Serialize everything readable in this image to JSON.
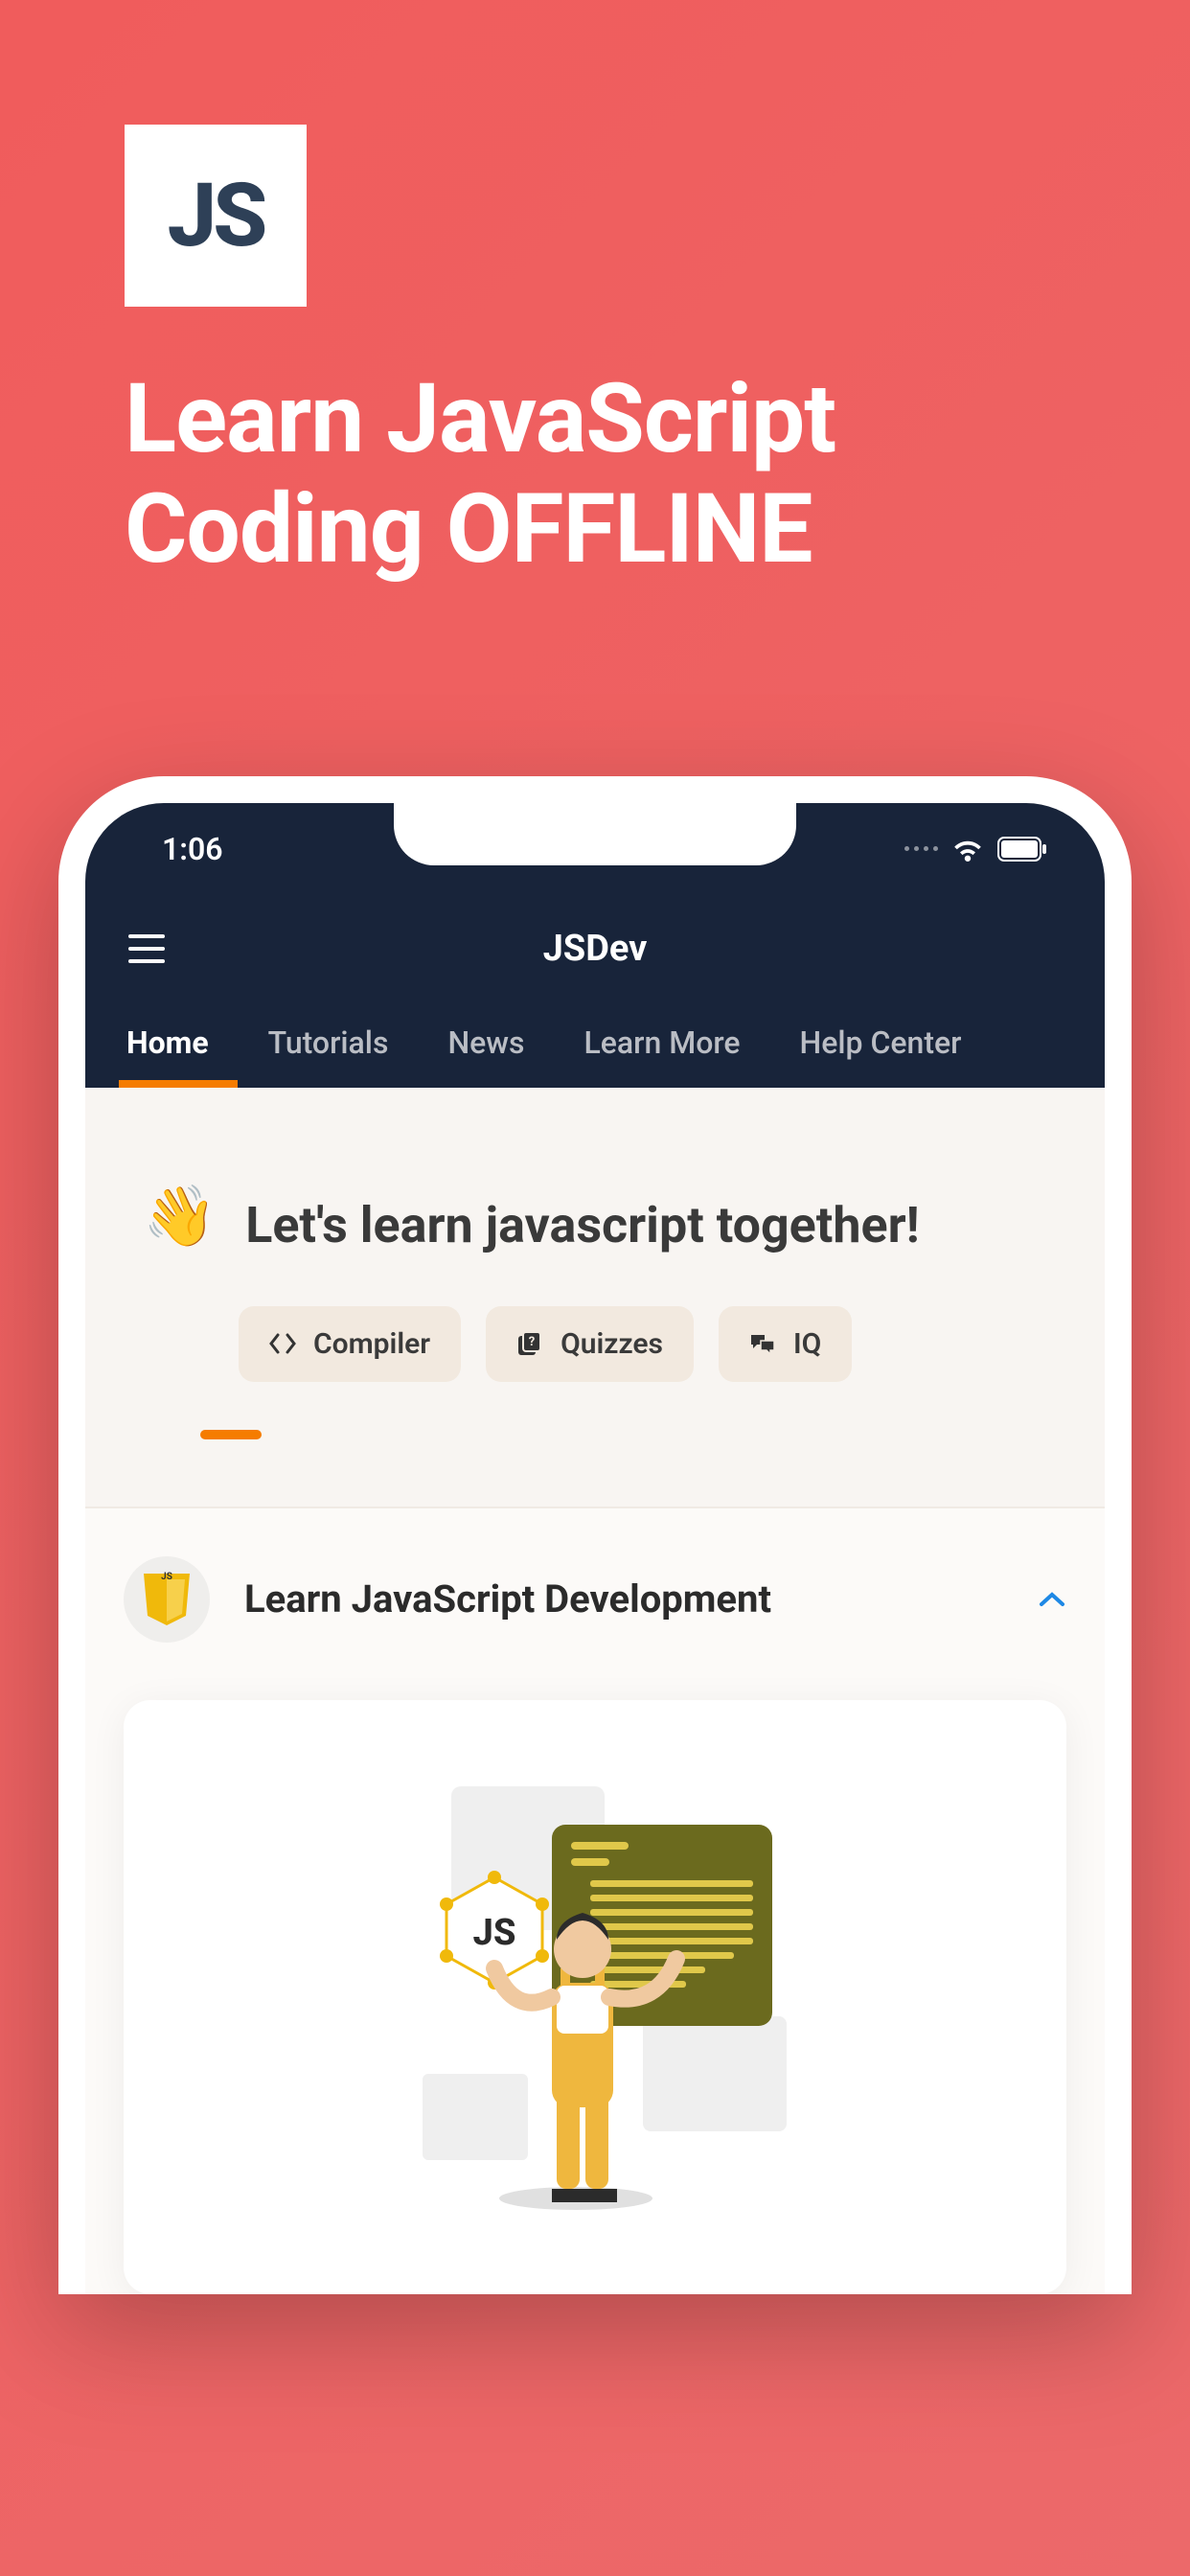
{
  "promo": {
    "logo_text": "JS",
    "headline_line1": "Learn JavaScript",
    "headline_line2": "Coding OFFLINE"
  },
  "status": {
    "time": "1:06"
  },
  "nav": {
    "app_title": "JSDev",
    "tabs": [
      {
        "label": "Home",
        "active": true
      },
      {
        "label": "Tutorials",
        "active": false
      },
      {
        "label": "News",
        "active": false
      },
      {
        "label": "Learn More",
        "active": false
      },
      {
        "label": "Help Center",
        "active": false
      }
    ]
  },
  "hero": {
    "wave_emoji": "👋",
    "text": "Let's learn javascript together!",
    "chips": [
      {
        "icon": "code",
        "label": "Compiler"
      },
      {
        "icon": "quiz",
        "label": "Quizzes"
      },
      {
        "icon": "chat",
        "label": "IQ"
      }
    ]
  },
  "learn_section": {
    "title": "Learn JavaScript Development",
    "expanded": true
  },
  "colors": {
    "brand_bg": "#EC696A",
    "header_dark": "#18243A",
    "accent": "#F57C00"
  }
}
